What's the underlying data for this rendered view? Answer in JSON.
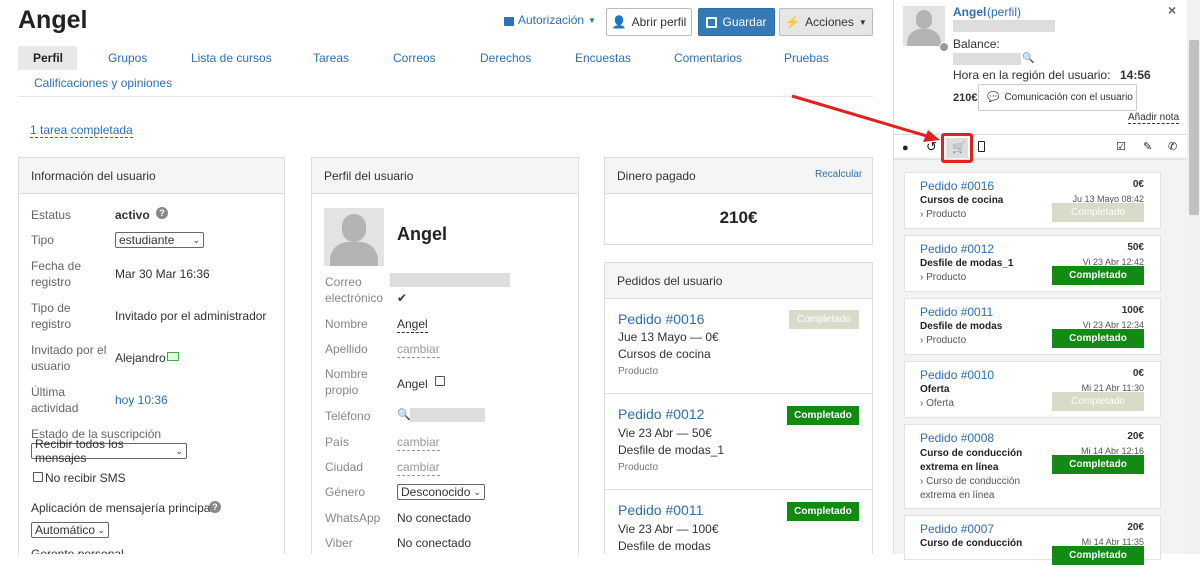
{
  "title": "Angel",
  "header": {
    "autorizacion": "Autorización",
    "abrir_perfil": "Abrir perfil",
    "guardar": "Guardar",
    "acciones": "Acciones"
  },
  "tabs": [
    "Perfil",
    "Grupos",
    "Lista de cursos",
    "Tareas",
    "Correos",
    "Derechos",
    "Encuestas",
    "Comentarios",
    "Pruebas",
    "Calificaciones y opiniones"
  ],
  "tasks_done": "1 tarea completada",
  "info": {
    "title": "Información del usuario",
    "estatus_l": "Estatus",
    "estatus_v": "activo",
    "tipo_l": "Tipo",
    "tipo_v": "estudiante",
    "fecha_l": "Fecha de registro",
    "fecha_v": "Mar 30 Mar 16:36",
    "tiporeg_l": "Tipo de registro",
    "tiporeg_v": "Invitado por el administrador",
    "invitado_l": "Invitado por el usuario",
    "invitado_v": "Alejandro",
    "ultima_l": "Última actividad",
    "ultima_v": "hoy 10:36",
    "suscr_l": "Estado de la suscripción",
    "suscr_v": "Recibir todos los mensajes",
    "sms": "No recibir SMS",
    "msg_l": "Aplicación de mensajería principal",
    "msg_v": "Automático",
    "gerente": "Gerente personal"
  },
  "profile": {
    "title": "Perfil del usuario",
    "name": "Angel",
    "correo_l": "Correo electrónico",
    "nombre_l": "Nombre",
    "nombre_v": "Angel",
    "apellido_l": "Apellido",
    "cambiar": "cambiar",
    "propio_l": "Nombre propio",
    "propio_v": "Angel",
    "tel_l": "Teléfono",
    "pais_l": "País",
    "ciudad_l": "Ciudad",
    "genero_l": "Género",
    "genero_v": "Desconocido",
    "wa_l": "WhatsApp",
    "wa_v": "No conectado",
    "viber_l": "Viber",
    "viber_v": "No conectado"
  },
  "money": {
    "title": "Dinero pagado",
    "recalc": "Recalcular",
    "amount": "210€"
  },
  "orders_main": {
    "title": "Pedidos del usuario",
    "items": [
      {
        "t": "Pedido #0016",
        "l1": "Jue 13 Mayo — 0€",
        "l2": "Cursos de cocina",
        "l3": "Producto",
        "status": "Completado"
      },
      {
        "t": "Pedido #0012",
        "l1": "Vie 23 Abr — 50€",
        "l2": "Desfile de modas_1",
        "l3": "Producto",
        "status": "Completado"
      },
      {
        "t": "Pedido #0011",
        "l1": "Vie 23 Abr — 100€",
        "l2": "Desfile de modas",
        "status": "Completado"
      }
    ]
  },
  "side": {
    "name": "Angel",
    "perfil": "(perfil)",
    "balance": "Balance:",
    "hora_l": "Hora en la región del usuario:",
    "hora_v": "14:56",
    "amount": "210€",
    "comm": "Comunicación con el usuario",
    "nota": "Añadir nota",
    "orders": [
      {
        "t": "Pedido #0016",
        "price": "0€",
        "date": "Ju 13 Mayo 08:42",
        "name": "Cursos de cocina",
        "sub": "› Producto",
        "status": "Completado"
      },
      {
        "t": "Pedido #0012",
        "price": "50€",
        "date": "Vi 23 Abr 12:42",
        "name": "Desfile de modas_1",
        "sub": "› Producto",
        "status": "Completado"
      },
      {
        "t": "Pedido #0011",
        "price": "100€",
        "date": "Vi 23 Abr 12:34",
        "name": "Desfile de modas",
        "sub": "› Producto",
        "status": "Completado"
      },
      {
        "t": "Pedido #0010",
        "price": "0€",
        "date": "Mi 21 Abr 11:30",
        "name": "Oferta",
        "sub": "› Oferta",
        "status": "Completado"
      },
      {
        "t": "Pedido #0008",
        "price": "20€",
        "date": "Mi 14 Abr 12:16",
        "name": "Curso de conducción extrema en línea",
        "sub": "› Curso de conducción extrema en línea",
        "status": "Completado"
      },
      {
        "t": "Pedido #0007",
        "price": "20€",
        "date": "Mi 14 Abr 11:35",
        "name": "Curso de conducción",
        "status": "Completado"
      }
    ]
  },
  "colors": {
    "link": "#2f6fb3",
    "primary": "#337ab7",
    "success": "#138a13",
    "muted_badge": "#d9dbc8",
    "highlight": "#e0221e"
  }
}
